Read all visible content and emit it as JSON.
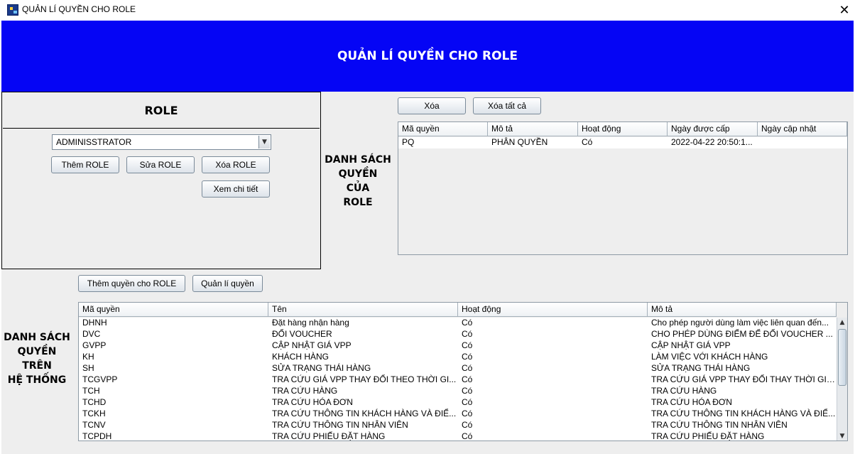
{
  "window": {
    "title": "QUẢN LÍ QUYỀN CHO ROLE",
    "close_glyph": "✕",
    "app_icon": "app-icon"
  },
  "banner": {
    "title": "QUẢN LÍ QUYỀN CHO ROLE",
    "color": "#0505f5"
  },
  "role_panel": {
    "header": "ROLE",
    "combo_value": "ADMINISSTRATOR",
    "combo_arrow": "▼",
    "add_label": "Thêm ROLE",
    "edit_label": "Sửa ROLE",
    "delete_label": "Xóa ROLE",
    "detail_label": "Xem chi tiết"
  },
  "role_permissions": {
    "label_line1": "DANH SÁCH",
    "label_line2": "QUYỀN",
    "label_line3": "CỦA",
    "label_line4": "ROLE",
    "delete_label": "Xóa",
    "delete_all_label": "Xóa tất cả",
    "columns": [
      "Mã quyền",
      "Mô tả",
      "Hoạt động",
      "Ngày được cấp",
      "Ngày cập nhật"
    ],
    "rows": [
      [
        "PQ",
        "PHÂN QUYỀN",
        "Có",
        "2022-04-22 20:50:1...",
        ""
      ]
    ]
  },
  "actions": {
    "add_permission_label": "Thêm quyền cho ROLE",
    "manage_permissions_label": "Quản lí quyền"
  },
  "system_permissions": {
    "label_line1": "DANH SÁCH",
    "label_line2": "QUYỀN",
    "label_line3": "TRÊN",
    "label_line4": "HỆ THỐNG",
    "columns": [
      "Mã quyền",
      "Tên",
      "Hoạt động",
      "Mô tả"
    ],
    "rows": [
      [
        "DHNH",
        "Đặt hàng nhận hàng",
        "Có",
        "Cho phép người dùng làm việc liên quan đến..."
      ],
      [
        "DVC",
        "ĐỔI VOUCHER",
        "Có",
        "CHO PHÉP DÙNG ĐIỂM ĐỂ ĐỔI VOUCHER ..."
      ],
      [
        "GVPP",
        "CẬP NHẬT GIÁ VPP",
        "Có",
        "CẬP NHẬT GIÁ VPP"
      ],
      [
        "KH",
        "KHÁCH HÀNG",
        "Có",
        "LÀM VIỆC VỚI KHÁCH HÀNG"
      ],
      [
        "SH",
        "SỬA TRẠNG THÁI HÀNG",
        "Có",
        "SỬA TRẠNG THÁI HÀNG"
      ],
      [
        "TCGVPP",
        "TRA CỨU GIÁ VPP THAY ĐỔI THEO THỜI GI...",
        "Có",
        "TRA CỨU GIÁ VPP THAY ĐỔI THAY THỜI GIAN"
      ],
      [
        "TCH",
        "TRA CỨU HÀNG",
        "Có",
        "TRA CỨU HÀNG"
      ],
      [
        "TCHD",
        "TRA CỨU HÓA ĐƠN",
        "Có",
        "TRA CỨU HÓA ĐƠN"
      ],
      [
        "TCKH",
        "TRA CỨU THÔNG TIN KHÁCH HÀNG VÀ ĐIỂ...",
        "Có",
        "TRA CỨU THÔNG TIN KHÁCH HÀNG VÀ ĐIỂ..."
      ],
      [
        "TCNV",
        "TRA CỨU THÔNG TIN NHÂN VIÊN",
        "Có",
        "TRA CỨU THÔNG TIN NHÂN VIÊN"
      ],
      [
        "TCPDH",
        "TRA CỨU PHIẾU ĐẶT HÀNG",
        "Có",
        "TRA CỨU PHIẾU ĐẶT HÀNG"
      ]
    ],
    "scroll_up": "▲",
    "scroll_down": "▼"
  }
}
